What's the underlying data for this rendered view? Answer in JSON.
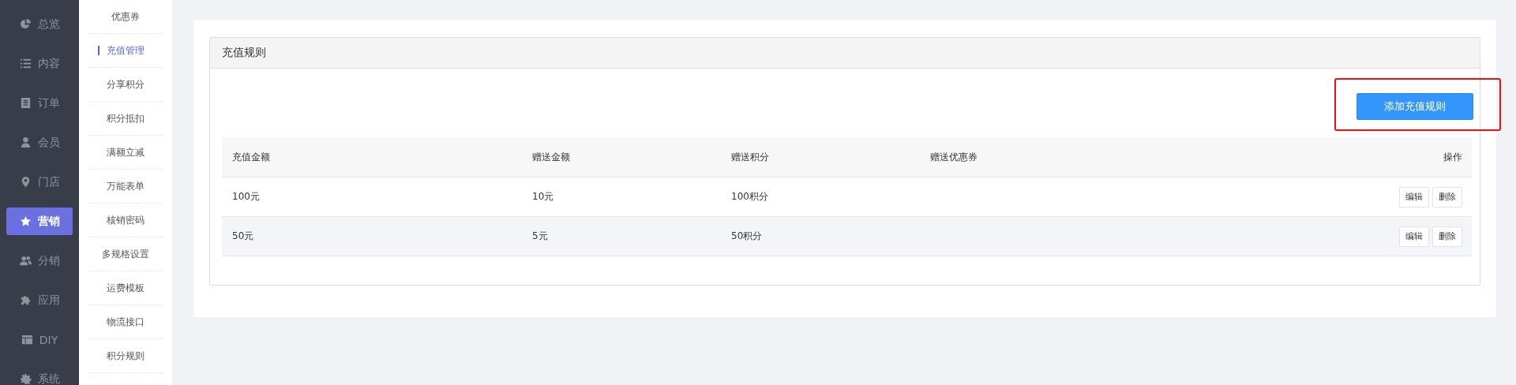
{
  "main_nav": [
    {
      "label": "总览",
      "selected": false
    },
    {
      "label": "内容",
      "selected": false
    },
    {
      "label": "订单",
      "selected": false
    },
    {
      "label": "会员",
      "selected": false
    },
    {
      "label": "门店",
      "selected": false
    },
    {
      "label": "营销",
      "selected": true
    },
    {
      "label": "分销",
      "selected": false
    },
    {
      "label": "应用",
      "selected": false
    },
    {
      "label": "DIY",
      "selected": false
    },
    {
      "label": "系统",
      "selected": false
    }
  ],
  "sub_nav": [
    {
      "label": "优惠券",
      "selected": false
    },
    {
      "label": "充值管理",
      "selected": true
    },
    {
      "label": "分享积分",
      "selected": false
    },
    {
      "label": "积分抵扣",
      "selected": false
    },
    {
      "label": "满额立减",
      "selected": false
    },
    {
      "label": "万能表单",
      "selected": false
    },
    {
      "label": "核销密码",
      "selected": false
    },
    {
      "label": "多规格设置",
      "selected": false
    },
    {
      "label": "运费模板",
      "selected": false
    },
    {
      "label": "物流接口",
      "selected": false
    },
    {
      "label": "积分规则",
      "selected": false
    }
  ],
  "card": {
    "title": "充值规则",
    "add_button": "添加充值规则",
    "table": {
      "columns": [
        "充值金额",
        "赠送金额",
        "赠送积分",
        "赠送优惠券",
        "操作"
      ],
      "rows": [
        {
          "cells": [
            "100元",
            "10元",
            "100积分",
            ""
          ],
          "actions": [
            "编辑",
            "删除"
          ]
        },
        {
          "cells": [
            "50元",
            "5元",
            "50积分",
            ""
          ],
          "actions": [
            "编辑",
            "删除"
          ]
        }
      ]
    }
  }
}
